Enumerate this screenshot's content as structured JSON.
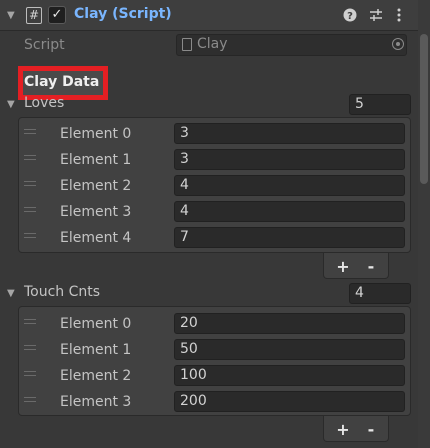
{
  "component": {
    "title": "Clay (Script)",
    "enabled_glyph": "✓",
    "script_icon_glyph": "#",
    "icons": [
      "help-icon",
      "presets-icon",
      "kebab-menu-icon"
    ]
  },
  "script_field": {
    "label": "Script",
    "value": "Clay"
  },
  "header_label": "Clay Data",
  "loves": {
    "label": "Loves",
    "size": "5",
    "elements": [
      {
        "label": "Element 0",
        "value": "3"
      },
      {
        "label": "Element 1",
        "value": "3"
      },
      {
        "label": "Element 2",
        "value": "4"
      },
      {
        "label": "Element 3",
        "value": "4"
      },
      {
        "label": "Element 4",
        "value": "7"
      }
    ]
  },
  "touch_cnts": {
    "label": "Touch Cnts",
    "size": "4",
    "elements": [
      {
        "label": "Element 0",
        "value": "20"
      },
      {
        "label": "Element 1",
        "value": "50"
      },
      {
        "label": "Element 2",
        "value": "100"
      },
      {
        "label": "Element 3",
        "value": "200"
      }
    ]
  },
  "list_footer": {
    "add": "+",
    "remove": "-"
  },
  "colors": {
    "title": "#7ab6ff",
    "highlight": "#e41f23",
    "background": "#383838"
  }
}
